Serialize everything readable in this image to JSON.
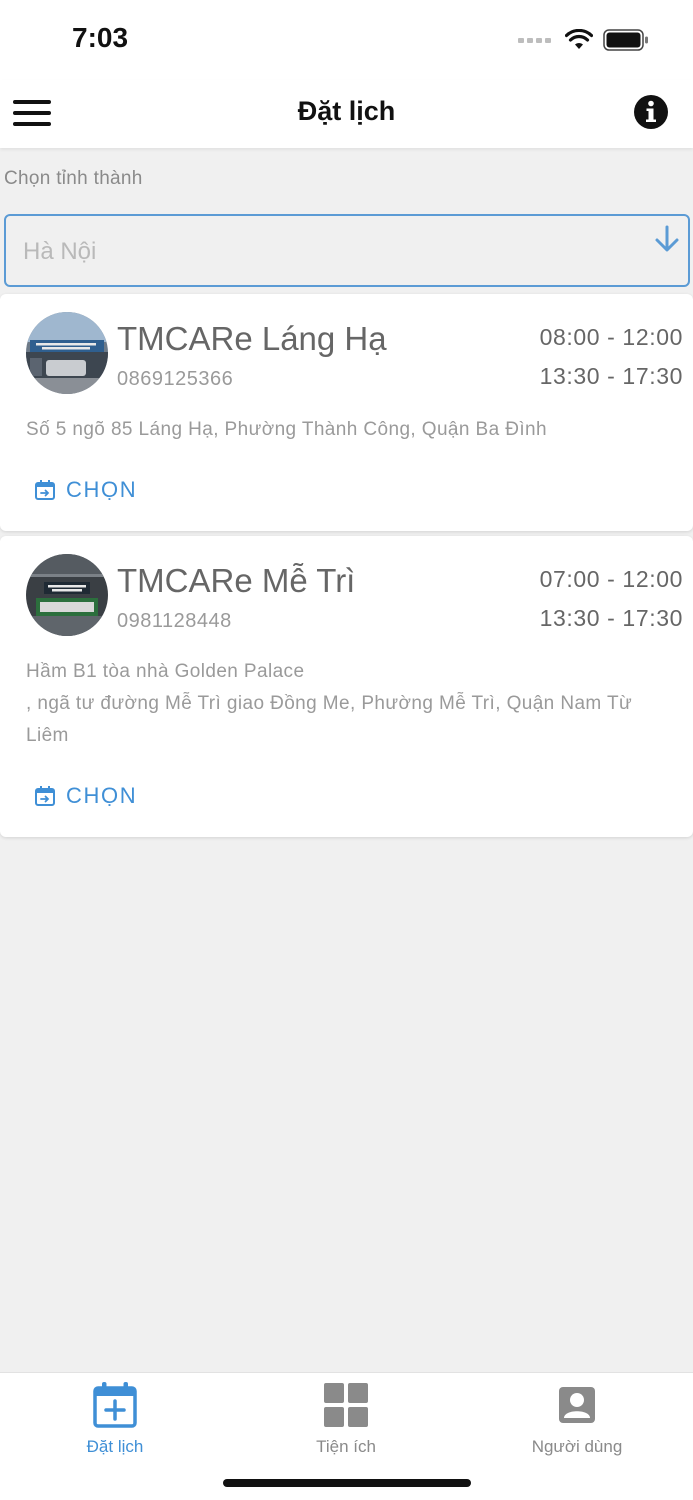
{
  "status_bar": {
    "time": "7:03"
  },
  "header": {
    "title": "Đặt lịch"
  },
  "province": {
    "label": "Chọn tỉnh thành",
    "value": "Hà Nội"
  },
  "stores": [
    {
      "name": "TMCARe Láng Hạ",
      "phone": "0869125366",
      "hours": [
        "08:00 - 12:00",
        "13:30 - 17:30"
      ],
      "address": "Số 5 ngõ 85 Láng Hạ, Phường Thành Công, Quận Ba Đình",
      "action_label": "CHỌN"
    },
    {
      "name": "TMCARe Mễ Trì",
      "phone": "0981128448",
      "hours": [
        "07:00 - 12:00",
        "13:30 - 17:30"
      ],
      "address_line1": "Hầm B1 tòa nhà Golden Palace",
      "address_line2": ", ngã tư đường Mễ Trì giao Đồng Me, Phường Mễ Trì, Quận Nam Từ Liêm",
      "action_label": "CHỌN"
    }
  ],
  "tabs": [
    {
      "label": "Đặt lịch",
      "icon": "calendar-plus-icon",
      "active": true
    },
    {
      "label": "Tiện ích",
      "icon": "grid-icon",
      "active": false
    },
    {
      "label": "Người dùng",
      "icon": "user-icon",
      "active": false
    }
  ],
  "colors": {
    "accent": "#3f8fd6",
    "background": "#f0f0f0",
    "card": "#ffffff"
  }
}
